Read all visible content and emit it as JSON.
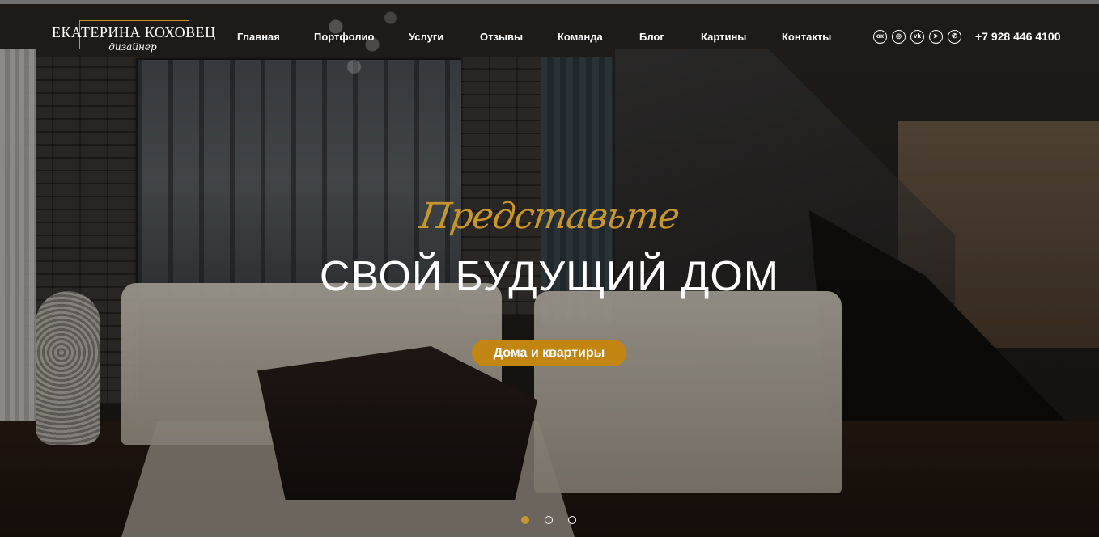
{
  "logo": {
    "name": "Екатерина Коховец",
    "subtitle": "дизайнер"
  },
  "nav": [
    {
      "label": "Главная"
    },
    {
      "label": "Портфолио"
    },
    {
      "label": "Услуги"
    },
    {
      "label": "Отзывы"
    },
    {
      "label": "Команда"
    },
    {
      "label": "Блог"
    },
    {
      "label": "Картины"
    },
    {
      "label": "Контакты"
    }
  ],
  "social": [
    {
      "icon": "odnoklassniki-icon",
      "glyph": "ок"
    },
    {
      "icon": "instagram-icon",
      "glyph": "◎"
    },
    {
      "icon": "vk-icon",
      "glyph": "vk"
    },
    {
      "icon": "telegram-icon",
      "glyph": "➤"
    },
    {
      "icon": "whatsapp-icon",
      "glyph": "✆"
    }
  ],
  "phone": "+7 928 446 4100",
  "hero": {
    "script": "Представьте",
    "title": "СВОЙ БУДУЩИЙ ДОМ",
    "button_label": "Дома и квартиры"
  },
  "slider": {
    "count": 3,
    "active_index": 0
  },
  "colors": {
    "accent": "#c8962a",
    "button": "#c28512",
    "text": "#ffffff"
  }
}
